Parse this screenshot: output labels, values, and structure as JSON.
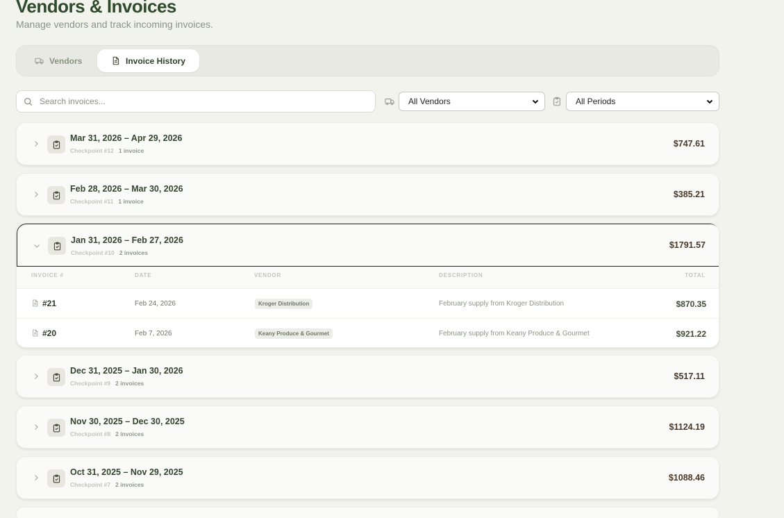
{
  "header": {
    "title": "Vendors & Invoices",
    "subtitle": "Manage vendors and track incoming invoices."
  },
  "tabs": {
    "vendors": "Vendors",
    "history": "Invoice History"
  },
  "filters": {
    "search_placeholder": "Search invoices...",
    "vendor_selected": "All Vendors",
    "period_selected": "All Periods"
  },
  "periods": [
    {
      "range": "Mar 31, 2026 – Apr 29, 2026",
      "checkpoint": "Checkpoint #12",
      "count": "1 invoice",
      "total": "$747.61"
    },
    {
      "range": "Feb 28, 2026 – Mar 30, 2026",
      "checkpoint": "Checkpoint #11",
      "count": "1 invoice",
      "total": "$385.21"
    },
    {
      "range": "Jan 31, 2026 – Feb 27, 2026",
      "checkpoint": "Checkpoint #10",
      "count": "2 invoices",
      "total": "$1791.57"
    },
    {
      "range": "Dec 31, 2025 – Jan 30, 2026",
      "checkpoint": "Checkpoint #9",
      "count": "2 invoices",
      "total": "$517.11"
    },
    {
      "range": "Nov 30, 2025 – Dec 30, 2025",
      "checkpoint": "Checkpoint #8",
      "count": "2 invoices",
      "total": "$1124.19"
    },
    {
      "range": "Oct 31, 2025 – Nov 29, 2025",
      "checkpoint": "Checkpoint #7",
      "count": "2 invoices",
      "total": "$1088.46"
    }
  ],
  "invoice_table": {
    "columns": [
      "INVOICE #",
      "DATE",
      "VENDOR",
      "DESCRIPTION",
      "TOTAL"
    ],
    "rows": [
      {
        "number": "#21",
        "date": "Feb 24, 2026",
        "vendor": "Kroger Distribution",
        "description": "February supply from Kroger Distribution",
        "total": "$870.35"
      },
      {
        "number": "#20",
        "date": "Feb 7, 2026",
        "vendor": "Keany Produce & Gourmet",
        "description": "February supply from Keany Produce & Gourmet",
        "total": "$921.22"
      }
    ]
  }
}
